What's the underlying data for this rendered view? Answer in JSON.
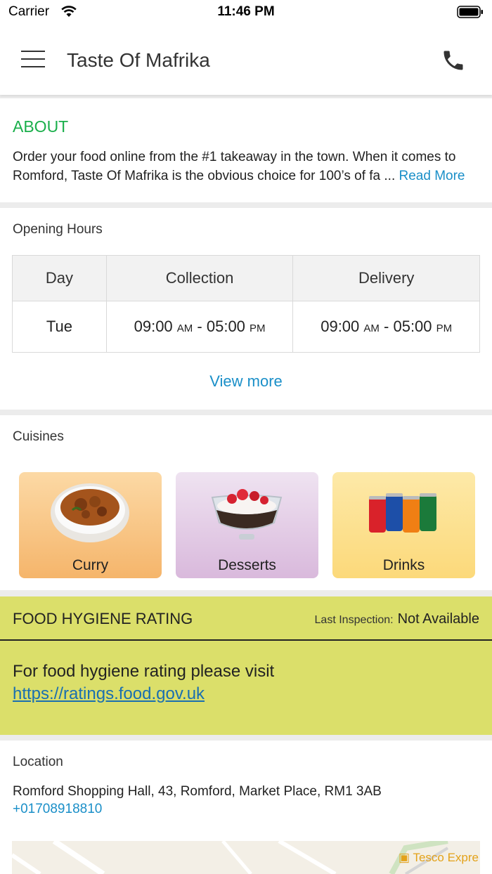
{
  "status_bar": {
    "carrier": "Carrier",
    "time": "11:46 PM"
  },
  "header": {
    "title": "Taste Of Mafrika"
  },
  "about": {
    "heading": "ABOUT",
    "text": "Order your food online from the #1 takeaway in the town. When it comes to Romford, Taste Of Mafrika is the obvious choice for 100’s of fa ...",
    "read_more": "Read More"
  },
  "opening_hours": {
    "label": "Opening Hours",
    "columns": [
      "Day",
      "Collection",
      "Delivery"
    ],
    "rows": [
      {
        "day": "Tue",
        "collection_from": "09:00",
        "collection_from_ampm": "AM",
        "collection_to": "05:00",
        "collection_to_ampm": "PM",
        "delivery_from": "09:00",
        "delivery_from_ampm": "AM",
        "delivery_to": "05:00",
        "delivery_to_ampm": "PM"
      }
    ],
    "view_more": "View more"
  },
  "cuisines": {
    "label": "Cuisines",
    "items": [
      {
        "name": "Curry"
      },
      {
        "name": "Desserts"
      },
      {
        "name": "Drinks"
      }
    ]
  },
  "hygiene": {
    "title": "FOOD HYGIENE RATING",
    "inspection_label": "Last Inspection:",
    "inspection_value": "Not Available",
    "message": "For food hygiene rating please visit",
    "link": "https://ratings.food.gov.uk"
  },
  "location": {
    "label": "Location",
    "address": "Romford Shopping Hall, 43, Romford, Market Place, RM1 3AB",
    "phone": "+01708918810",
    "map_poi": "Tesco Expre"
  },
  "colors": {
    "accent_green": "#1aaf4b",
    "link_blue": "#1a8fc8",
    "hygiene_bg": "#dbdf6a"
  }
}
